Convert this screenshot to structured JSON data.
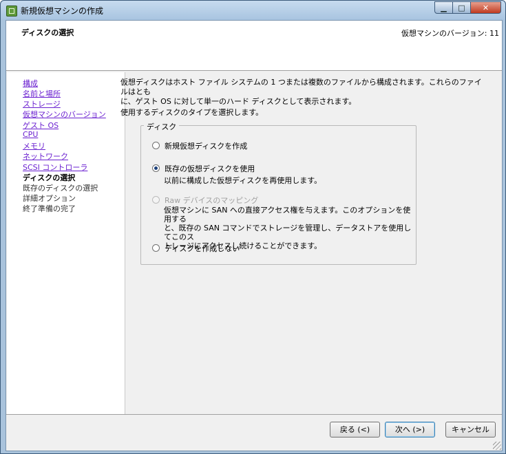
{
  "window": {
    "title": "新規仮想マシンの作成",
    "min_glyph": "▁",
    "max_glyph": "□",
    "close_glyph": "✕"
  },
  "header": {
    "title": "ディスクの選択",
    "version": "仮想マシンのバージョン: 11"
  },
  "nav": {
    "items": [
      {
        "label": "構成",
        "state": "link"
      },
      {
        "label": "名前と場所",
        "state": "link"
      },
      {
        "label": "ストレージ",
        "state": "link"
      },
      {
        "label": "仮想マシンのバージョン",
        "state": "link"
      },
      {
        "label": "ゲスト OS",
        "state": "link"
      },
      {
        "label": "CPU",
        "state": "link"
      },
      {
        "label": "メモリ",
        "state": "link"
      },
      {
        "label": "ネットワーク",
        "state": "link"
      },
      {
        "label": "SCSI コントローラ",
        "state": "link"
      },
      {
        "label": "ディスクの選択",
        "state": "current"
      },
      {
        "label": "既存のディスクの選択",
        "state": "pending"
      },
      {
        "label": "詳細オプション",
        "state": "pending"
      },
      {
        "label": "終了準備の完了",
        "state": "pending"
      }
    ]
  },
  "content": {
    "description_line1": "仮想ディスクはホスト ファイル システムの 1 つまたは複数のファイルから構成されます。これらのファイルはとも",
    "description_line2": "に、ゲスト OS に対して単一のハード ディスクとして表示されます。",
    "prompt": "使用するディスクのタイプを選択します。",
    "group_label": "ディスク",
    "options": {
      "new_disk": {
        "label": "新規仮想ディスクを作成",
        "checked": false,
        "enabled": true
      },
      "existing_disk": {
        "label": "既存の仮想ディスクを使用",
        "checked": true,
        "enabled": true,
        "desc": "以前に構成した仮想ディスクを再使用します。"
      },
      "raw_mapping": {
        "label": "Raw デバイスのマッピング",
        "checked": false,
        "enabled": false,
        "desc1": "仮想マシンに SAN への直接アクセス権を与えます。このオプションを使用する",
        "desc2": "と、既存の SAN コマンドでストレージを管理し、データストアを使用してこのス",
        "desc3": "トレージにアクセスし続けることができます。"
      },
      "no_disk": {
        "label": "ディスクを作成しない",
        "checked": false,
        "enabled": true
      }
    }
  },
  "buttons": {
    "back": "戻る (<)",
    "next": "次へ (>)",
    "cancel": "キャンセル"
  }
}
